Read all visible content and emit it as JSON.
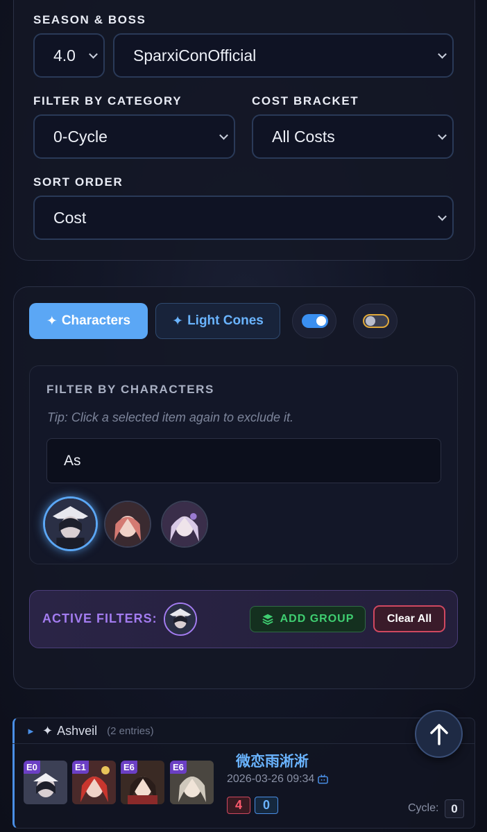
{
  "filters": {
    "season_boss_label": "SEASON & BOSS",
    "season_value": "4.0",
    "boss_value": "SparxiConOfficial",
    "category_label": "FILTER BY CATEGORY",
    "category_value": "0-Cycle",
    "cost_label": "COST BRACKET",
    "cost_value": "All Costs",
    "sort_label": "SORT ORDER",
    "sort_value": "Cost"
  },
  "tabs": {
    "characters": "Characters",
    "light_cones": "Light Cones",
    "toggle1_state": "on",
    "toggle2_state": "off"
  },
  "character_filter": {
    "title": "FILTER BY CHARACTERS",
    "tip": "Tip: Click a selected item again to exclude it.",
    "search_value": "As",
    "results": [
      "character-result-1",
      "character-result-2",
      "character-result-3"
    ]
  },
  "active_filters": {
    "label": "ACTIVE FILTERS:",
    "add_group": "ADD GROUP",
    "clear_all": "Clear All"
  },
  "group": {
    "name": "Ashveil",
    "entries": "(2 entries)",
    "entry": {
      "player": "微恋雨淅淅",
      "timestamp": "2026-03-26 09:34",
      "eidolons": [
        "E0",
        "E1",
        "E6",
        "E6"
      ],
      "stat_red": "4",
      "stat_blue": "0",
      "cycle_label": "Cycle:",
      "cycle_value": "0"
    }
  },
  "colors": {
    "accent_blue": "#5ba7f5",
    "accent_purple": "#a37cf0",
    "accent_green": "#3fce71",
    "accent_red": "#d04860"
  }
}
